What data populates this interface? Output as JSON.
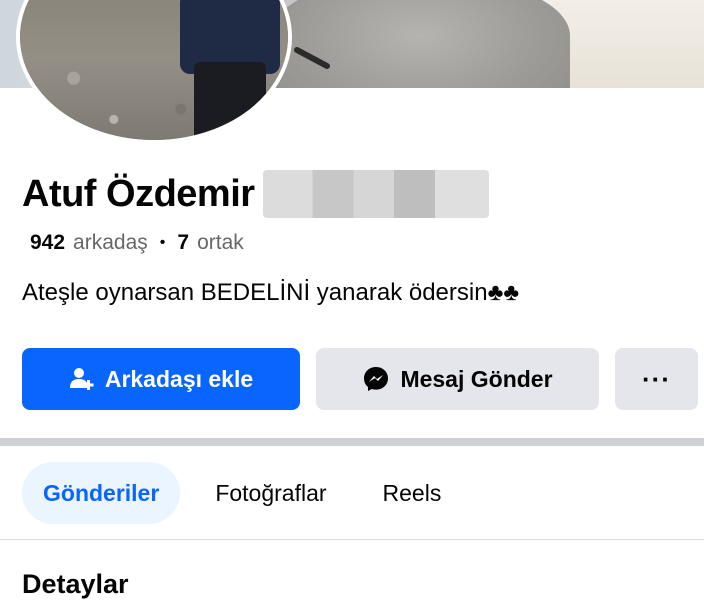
{
  "profile": {
    "name": "Atuf Özdemir",
    "friends_count": "942",
    "friends_label": "arkadaş",
    "separator": "•",
    "mutual_count": "7",
    "mutual_label": "ortak",
    "bio": "Ateşle oynarsan BEDELİNİ yanarak ödersin♣♣"
  },
  "actions": {
    "add_friend": "Arkadaşı ekle",
    "add_friend_icon": "add-friend-icon",
    "message": "Mesaj Gönder",
    "message_icon": "messenger-icon",
    "more": "···"
  },
  "tabs": [
    {
      "label": "Gönderiler",
      "active": true
    },
    {
      "label": "Fotoğraflar",
      "active": false
    },
    {
      "label": "Reels",
      "active": false
    }
  ],
  "sections": {
    "details_title": "Detaylar"
  },
  "colors": {
    "accent": "#0866ff",
    "secondary_button": "#e4e6eb",
    "active_tab_bg": "#ebf5ff",
    "muted_text": "#65676b"
  }
}
